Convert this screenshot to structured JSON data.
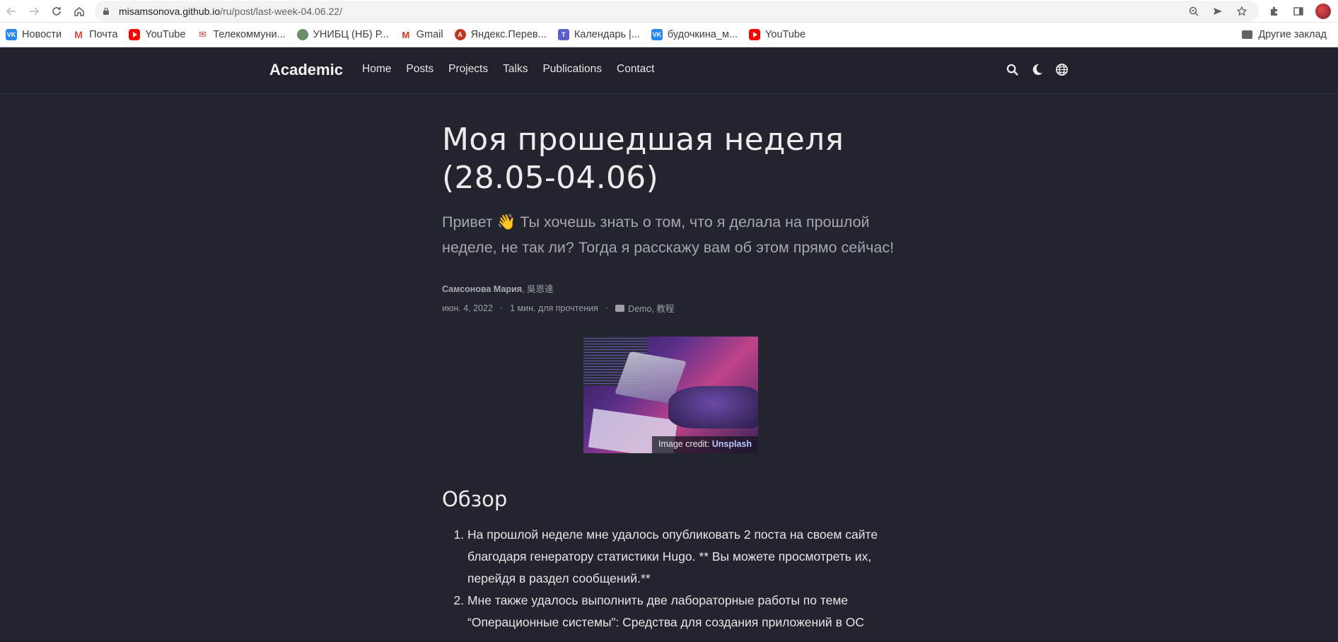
{
  "browser": {
    "url_host": "misamsonova.github.io",
    "url_path": "/ru/post/last-week-04.06.22/",
    "bookmarks": [
      {
        "icon": "vk-icon",
        "label": "Новости"
      },
      {
        "icon": "mail-icon",
        "label": "Почта"
      },
      {
        "icon": "youtube-icon",
        "label": "YouTube"
      },
      {
        "icon": "telecom-icon",
        "label": "Телекоммуни..."
      },
      {
        "icon": "unibc-icon",
        "label": "УНИБЦ (НБ) Р..."
      },
      {
        "icon": "gmail-icon",
        "label": "Gmail"
      },
      {
        "icon": "yandex-translate-icon",
        "label": "Яндекс.Перев..."
      },
      {
        "icon": "calendar-icon",
        "label": "Календарь |..."
      },
      {
        "icon": "vk-icon",
        "label": "будочкина_м..."
      },
      {
        "icon": "youtube-icon",
        "label": "YouTube"
      }
    ],
    "other_bookmarks": "Другие заклад"
  },
  "nav": {
    "brand": "Academic",
    "links": [
      "Home",
      "Posts",
      "Projects",
      "Talks",
      "Publications",
      "Contact"
    ]
  },
  "article": {
    "title": "Моя прошедшая неделя (28.05-04.06)",
    "subtitle": "Привет 👋 Ты хочешь знать о том, что я делала на прошлой неделе, не так ли? Тогда я расскажу вам об этом прямо сейчас!",
    "author_main": "Самсонова Мария",
    "author_second": ", 吳恩達",
    "date": "июн. 4, 2022",
    "read_time": "1 мин. для прочтения",
    "categories": "Demo, 教程",
    "image_credit_prefix": "Image credit: ",
    "image_credit_link": "Unsplash",
    "section_heading": "Обзор",
    "items": [
      "На прошлой неделе мне удалось опубликовать 2 поста на своем сайте благодаря генератору статистики Hugo. ** Вы можете просмотреть их, перейдя в раздел сообщений.**",
      "Мне также удалось выполнить две лабораторные работы по теме “Операционные системы”: Средства для создания приложений в ОС"
    ]
  }
}
